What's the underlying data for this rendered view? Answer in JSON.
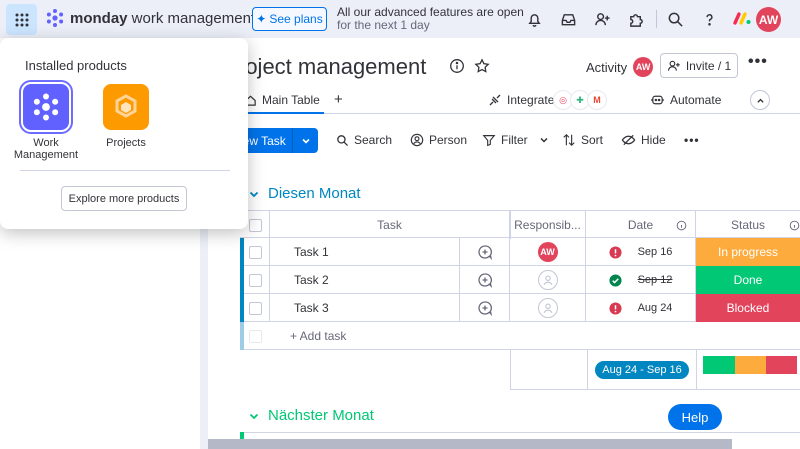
{
  "topbar": {
    "brand_bold": "monday",
    "brand_rest": " work management",
    "see_plans": "See plans",
    "promo_line1": "All our advanced features are open",
    "promo_line2": "for the next 1 day",
    "avatar": "AW",
    "icons": [
      "apps-grid-icon",
      "bell-icon",
      "inbox-icon",
      "invite-user-icon",
      "puzzle-icon",
      "search-icon",
      "help-icon"
    ]
  },
  "popup": {
    "title": "Installed products",
    "products": [
      {
        "name_line1": "Work",
        "name_line2": "Management",
        "color": "#6161ff"
      },
      {
        "name_line1": "Projects",
        "name_line2": "",
        "color": "#fd9a00"
      }
    ],
    "explore": "Explore more products"
  },
  "board": {
    "title": "roject management",
    "activity": "Activity",
    "activity_avatar": "AW",
    "invite": "Invite / 1",
    "tabs": {
      "main": "Main Table",
      "plus": "+"
    },
    "integrate": "Integrate",
    "automate": "Automate"
  },
  "toolbar": {
    "new_task": "New Task",
    "search": "Search",
    "person": "Person",
    "filter": "Filter",
    "sort": "Sort",
    "hide": "Hide"
  },
  "groups": [
    {
      "title": "Diesen Monat",
      "color": "#0086c0"
    },
    {
      "title": "Nächster Monat",
      "color": "#00c875"
    }
  ],
  "columns": {
    "task": "Task",
    "owner": "Responsib...",
    "date": "Date",
    "status": "Status"
  },
  "rows": [
    {
      "task": "Task 1",
      "owner": "AW",
      "date": "Sep 16",
      "status": "In progress",
      "status_color": "#fdab3d",
      "date_state": "overdue"
    },
    {
      "task": "Task 2",
      "owner": "",
      "date": "Sep 12",
      "status": "Done",
      "status_color": "#00c875",
      "date_state": "done"
    },
    {
      "task": "Task 3",
      "owner": "",
      "date": "Aug 24",
      "status": "Blocked",
      "status_color": "#e2445c",
      "date_state": "overdue"
    }
  ],
  "add_task": "+ Add task",
  "summary": {
    "date_range": "Aug 24 - Sep 16"
  },
  "help": "Help"
}
